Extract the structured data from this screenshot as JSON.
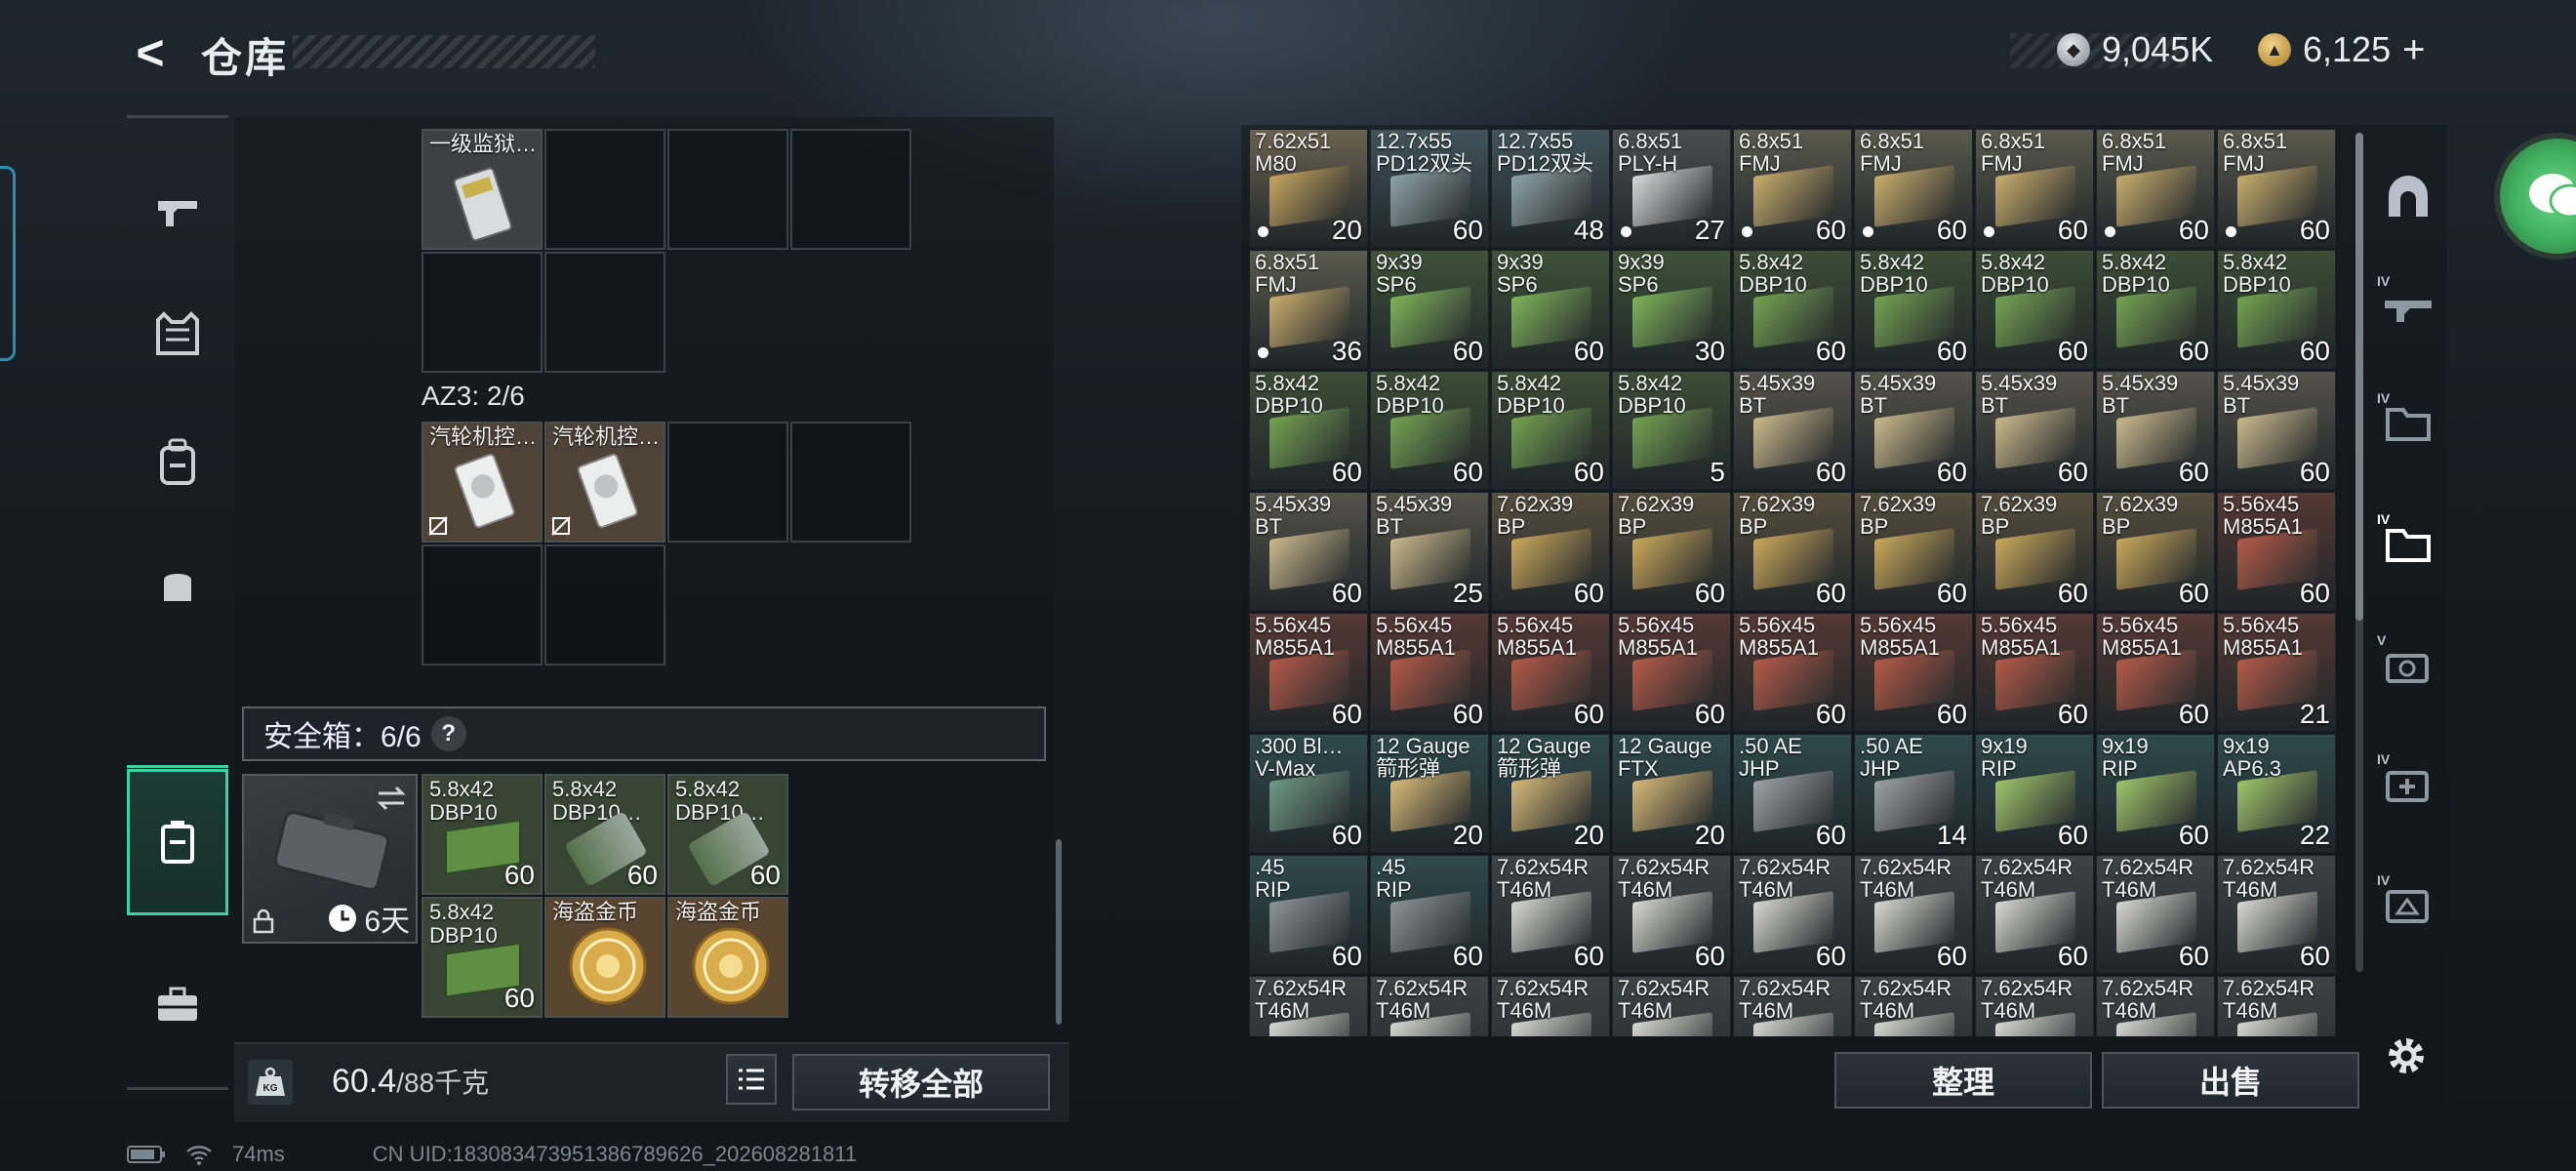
{
  "header": {
    "title": "仓库"
  },
  "currency": {
    "silver_amount": "9,045K",
    "gold_amount": "6,125",
    "gold_add": "+"
  },
  "container": {
    "item1_label": "一级监狱…",
    "az3_label": "AZ3: 2/6",
    "az3_items": [
      "汽轮机控…",
      "汽轮机控…"
    ]
  },
  "safe_box": {
    "label": "安全箱：6/6",
    "help": "?",
    "days": "6天",
    "items": [
      {
        "name": "5.8x42\nDBP10",
        "count": "60"
      },
      {
        "name": "5.8x42\nDBP10…",
        "count": "60"
      },
      {
        "name": "5.8x42\nDBP10…",
        "count": "60"
      },
      {
        "name": "5.8x42\nDBP10",
        "count": "60"
      },
      {
        "name": "海盗金币",
        "count": ""
      },
      {
        "name": "海盗金币",
        "count": ""
      }
    ]
  },
  "weight": {
    "current": "60.4",
    "max": "/88千克",
    "kg_icon": "KG"
  },
  "buttons": {
    "transfer_all": "转移全部",
    "organize": "整理",
    "sell": "出售"
  },
  "ammo": [
    {
      "name": "7.62x51\nM80",
      "count": "20",
      "color": "#c6a45e",
      "dot": true,
      "bg": "#6a6250"
    },
    {
      "name": "12.7x55\nPD12双头",
      "count": "60",
      "color": "#8ea3a8",
      "dot": false,
      "bg": "#41545a"
    },
    {
      "name": "12.7x55\nPD12双头",
      "count": "48",
      "color": "#8ea3a8",
      "dot": false,
      "bg": "#41545a"
    },
    {
      "name": "6.8x51\nPLY-H",
      "count": "27",
      "color": "#d8d8d8",
      "dot": true,
      "bg": "#4a4e4e"
    },
    {
      "name": "6.8x51\nFMJ",
      "count": "60",
      "color": "#c8ad6c",
      "dot": true,
      "bg": "#5a5a4c"
    },
    {
      "name": "6.8x51\nFMJ",
      "count": "60",
      "color": "#c8ad6c",
      "dot": true,
      "bg": "#5a5a4c"
    },
    {
      "name": "6.8x51\nFMJ",
      "count": "60",
      "color": "#c8ad6c",
      "dot": true,
      "bg": "#5a5a4c"
    },
    {
      "name": "6.8x51\nFMJ",
      "count": "60",
      "color": "#c8ad6c",
      "dot": true,
      "bg": "#5a5a4c"
    },
    {
      "name": "6.8x51\nFMJ",
      "count": "60",
      "color": "#c8ad6c",
      "dot": true,
      "bg": "#5a5a4c"
    },
    {
      "name": "6.8x51\nFMJ",
      "count": "36",
      "color": "#c8ad6c",
      "dot": true,
      "bg": "#5a5a4c"
    },
    {
      "name": "9x39\nSP6",
      "count": "60",
      "color": "#7eb35a",
      "dot": false,
      "bg": "#3f5238"
    },
    {
      "name": "9x39\nSP6",
      "count": "60",
      "color": "#7eb35a",
      "dot": false,
      "bg": "#3f5238"
    },
    {
      "name": "9x39\nSP6",
      "count": "30",
      "color": "#7eb35a",
      "dot": false,
      "bg": "#3f5238"
    },
    {
      "name": "5.8x42\nDBP10",
      "count": "60",
      "color": "#74a352",
      "dot": false,
      "bg": "#3d4d36"
    },
    {
      "name": "5.8x42\nDBP10",
      "count": "60",
      "color": "#74a352",
      "dot": false,
      "bg": "#3d4d36"
    },
    {
      "name": "5.8x42\nDBP10",
      "count": "60",
      "color": "#74a352",
      "dot": false,
      "bg": "#3d4d36"
    },
    {
      "name": "5.8x42\nDBP10",
      "count": "60",
      "color": "#74a352",
      "dot": false,
      "bg": "#3d4d36"
    },
    {
      "name": "5.8x42\nDBP10",
      "count": "60",
      "color": "#74a352",
      "dot": false,
      "bg": "#3d4d36"
    },
    {
      "name": "5.8x42\nDBP10",
      "count": "60",
      "color": "#74a352",
      "dot": false,
      "bg": "#3d4d36"
    },
    {
      "name": "5.8x42\nDBP10",
      "count": "60",
      "color": "#74a352",
      "dot": false,
      "bg": "#3d4d36"
    },
    {
      "name": "5.8x42\nDBP10",
      "count": "60",
      "color": "#74a352",
      "dot": false,
      "bg": "#3d4d36"
    },
    {
      "name": "5.8x42\nDBP10",
      "count": "5",
      "color": "#74a352",
      "dot": false,
      "bg": "#3d4d36"
    },
    {
      "name": "5.45x39\nBT",
      "count": "60",
      "color": "#c9b98c",
      "dot": false,
      "bg": "#55534a"
    },
    {
      "name": "5.45x39\nBT",
      "count": "60",
      "color": "#c9b98c",
      "dot": false,
      "bg": "#55534a"
    },
    {
      "name": "5.45x39\nBT",
      "count": "60",
      "color": "#c9b98c",
      "dot": false,
      "bg": "#55534a"
    },
    {
      "name": "5.45x39\nBT",
      "count": "60",
      "color": "#c9b98c",
      "dot": false,
      "bg": "#55534a"
    },
    {
      "name": "5.45x39\nBT",
      "count": "60",
      "color": "#c9b98c",
      "dot": false,
      "bg": "#55534a"
    },
    {
      "name": "5.45x39\nBT",
      "count": "60",
      "color": "#c9b98c",
      "dot": false,
      "bg": "#55534a"
    },
    {
      "name": "5.45x39\nBT",
      "count": "25",
      "color": "#c9b98c",
      "dot": false,
      "bg": "#55534a"
    },
    {
      "name": "7.62x39\nBP",
      "count": "60",
      "color": "#c9a85a",
      "dot": false,
      "bg": "#564e3e"
    },
    {
      "name": "7.62x39\nBP",
      "count": "60",
      "color": "#c9a85a",
      "dot": false,
      "bg": "#564e3e"
    },
    {
      "name": "7.62x39\nBP",
      "count": "60",
      "color": "#c9a85a",
      "dot": false,
      "bg": "#564e3e"
    },
    {
      "name": "7.62x39\nBP",
      "count": "60",
      "color": "#c9a85a",
      "dot": false,
      "bg": "#564e3e"
    },
    {
      "name": "7.62x39\nBP",
      "count": "60",
      "color": "#c9a85a",
      "dot": false,
      "bg": "#564e3e"
    },
    {
      "name": "7.62x39\nBP",
      "count": "60",
      "color": "#c9a85a",
      "dot": false,
      "bg": "#564e3e"
    },
    {
      "name": "5.56x45\nM855A1",
      "count": "60",
      "color": "#b65a48",
      "dot": false,
      "bg": "#553934"
    },
    {
      "name": "5.56x45\nM855A1",
      "count": "60",
      "color": "#b65a48",
      "dot": false,
      "bg": "#553934"
    },
    {
      "name": "5.56x45\nM855A1",
      "count": "60",
      "color": "#b65a48",
      "dot": false,
      "bg": "#553934"
    },
    {
      "name": "5.56x45\nM855A1",
      "count": "60",
      "color": "#b65a48",
      "dot": false,
      "bg": "#553934"
    },
    {
      "name": "5.56x45\nM855A1",
      "count": "60",
      "color": "#b65a48",
      "dot": false,
      "bg": "#553934"
    },
    {
      "name": "5.56x45\nM855A1",
      "count": "60",
      "color": "#b65a48",
      "dot": false,
      "bg": "#553934"
    },
    {
      "name": "5.56x45\nM855A1",
      "count": "60",
      "color": "#b65a48",
      "dot": false,
      "bg": "#553934"
    },
    {
      "name": "5.56x45\nM855A1",
      "count": "60",
      "color": "#b65a48",
      "dot": false,
      "bg": "#553934"
    },
    {
      "name": "5.56x45\nM855A1",
      "count": "60",
      "color": "#b65a48",
      "dot": false,
      "bg": "#553934"
    },
    {
      "name": "5.56x45\nM855A1",
      "count": "21",
      "color": "#b65a48",
      "dot": false,
      "bg": "#553934"
    },
    {
      "name": ".300 Bl…\nV-Max",
      "count": "60",
      "color": "#6f9a86",
      "dot": false,
      "bg": "#2f4a4c"
    },
    {
      "name": "12 Gauge\n箭形弹",
      "count": "20",
      "color": "#d6b978",
      "dot": false,
      "bg": "#2f4a4c"
    },
    {
      "name": "12 Gauge\n箭形弹",
      "count": "20",
      "color": "#d6b978",
      "dot": false,
      "bg": "#2f4a4c"
    },
    {
      "name": "12 Gauge\nFTX",
      "count": "20",
      "color": "#d6b978",
      "dot": false,
      "bg": "#2f4a4c"
    },
    {
      "name": ".50 AE\nJHP",
      "count": "60",
      "color": "#9ea2a6",
      "dot": false,
      "bg": "#2f4a4c"
    },
    {
      "name": ".50 AE\nJHP",
      "count": "14",
      "color": "#9ea2a6",
      "dot": false,
      "bg": "#2f4a4c"
    },
    {
      "name": "9x19\nRIP",
      "count": "60",
      "color": "#9fc46a",
      "dot": false,
      "bg": "#2f4a4c"
    },
    {
      "name": "9x19\nRIP",
      "count": "60",
      "color": "#9fc46a",
      "dot": false,
      "bg": "#2f4a4c"
    },
    {
      "name": "9x19\nAP6.3",
      "count": "22",
      "color": "#9fc46a",
      "dot": false,
      "bg": "#2f4a4c"
    },
    {
      "name": ".45\nRIP",
      "count": "60",
      "color": "#8c9398",
      "dot": false,
      "bg": "#2f4a4c"
    },
    {
      "name": ".45\nRIP",
      "count": "60",
      "color": "#8c9398",
      "dot": false,
      "bg": "#2f4a4c"
    },
    {
      "name": "7.62x54R\nT46M",
      "count": "60",
      "color": "#d8d8d2",
      "dot": false,
      "bg": "#3e4446"
    },
    {
      "name": "7.62x54R\nT46M",
      "count": "60",
      "color": "#d8d8d2",
      "dot": false,
      "bg": "#3e4446"
    },
    {
      "name": "7.62x54R\nT46M",
      "count": "60",
      "color": "#d8d8d2",
      "dot": false,
      "bg": "#3e4446"
    },
    {
      "name": "7.62x54R\nT46M",
      "count": "60",
      "color": "#d8d8d2",
      "dot": false,
      "bg": "#3e4446"
    },
    {
      "name": "7.62x54R\nT46M",
      "count": "60",
      "color": "#d8d8d2",
      "dot": false,
      "bg": "#3e4446"
    },
    {
      "name": "7.62x54R\nT46M",
      "count": "60",
      "color": "#d8d8d2",
      "dot": false,
      "bg": "#3e4446"
    },
    {
      "name": "7.62x54R\nT46M",
      "count": "60",
      "color": "#d8d8d2",
      "dot": false,
      "bg": "#3e4446"
    },
    {
      "name": "7.62x54R\nT46M",
      "count": "",
      "color": "#d8d8d2",
      "dot": false,
      "bg": "#3e4446"
    },
    {
      "name": "7.62x54R\nT46M",
      "count": "",
      "color": "#d8d8d2",
      "dot": false,
      "bg": "#3e4446"
    },
    {
      "name": "7.62x54R\nT46M",
      "count": "",
      "color": "#d8d8d2",
      "dot": false,
      "bg": "#3e4446"
    },
    {
      "name": "7.62x54R\nT46M",
      "count": "",
      "color": "#d8d8d2",
      "dot": false,
      "bg": "#3e4446"
    },
    {
      "name": "7.62x54R\nT46M",
      "count": "",
      "color": "#d8d8d2",
      "dot": false,
      "bg": "#3e4446"
    },
    {
      "name": "7.62x54R\nT46M",
      "count": "",
      "color": "#d8d8d2",
      "dot": false,
      "bg": "#3e4446"
    },
    {
      "name": "7.62x54R\nT46M",
      "count": "",
      "color": "#d8d8d2",
      "dot": false,
      "bg": "#3e4446"
    },
    {
      "name": "7.62x54R\nT46M",
      "count": "",
      "color": "#d8d8d2",
      "dot": false,
      "bg": "#3e4446"
    },
    {
      "name": "7.62x54R\nT46M",
      "count": "",
      "color": "#d8d8d2",
      "dot": false,
      "bg": "#3e4446"
    }
  ],
  "status": {
    "ping": "74ms",
    "uid": "CN UID:18308347395138678962​6_202608281811"
  },
  "accent": "#3fd1a6"
}
